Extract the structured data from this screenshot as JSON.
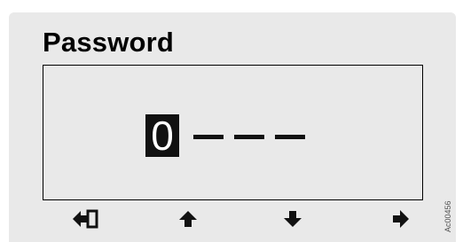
{
  "title": "Password",
  "password": {
    "active_digit": "0",
    "placeholders": [
      "–",
      "–",
      "–"
    ]
  },
  "softkeys": [
    {
      "icon": "enter-icon",
      "label": ""
    },
    {
      "icon": "arrow-up-icon",
      "label": ""
    },
    {
      "icon": "arrow-down-icon",
      "label": ""
    },
    {
      "icon": "arrow-right-icon",
      "label": ""
    }
  ],
  "figure_id": "Ac00456"
}
